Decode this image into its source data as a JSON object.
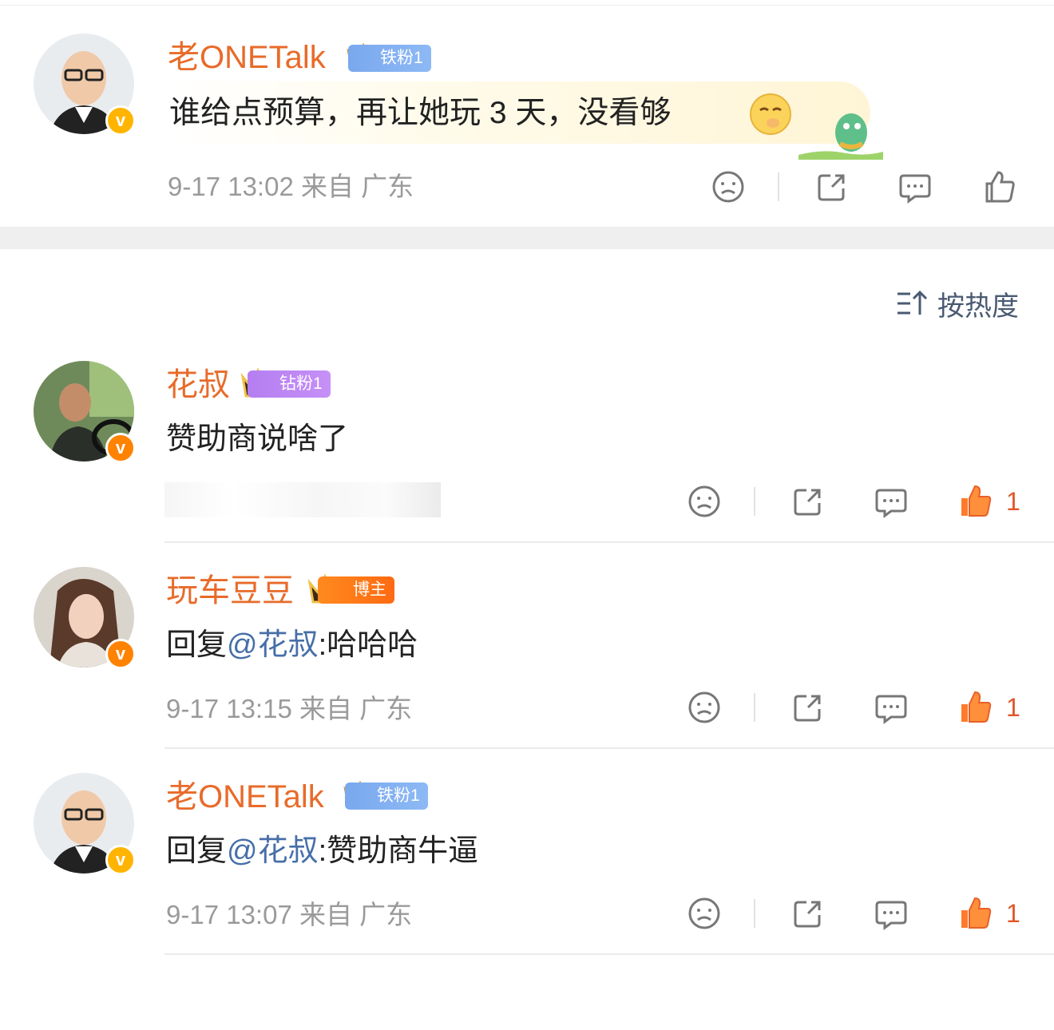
{
  "post": {
    "username": "老ONETalk",
    "fan_badge": "铁粉1",
    "text": "谁给点预算，再让她玩 3 天，没看够",
    "meta": "9-17 13:02  来自 广东"
  },
  "sort": {
    "label": "按热度",
    "icon": "sort-up-icon"
  },
  "comments": [
    {
      "username": "花叔",
      "fan_badge": "钻粉1",
      "text": "赞助商说啥了",
      "meta": "",
      "likes": "1"
    },
    {
      "username": "玩车豆豆",
      "fan_badge": "博主",
      "reply_prefix": "回复",
      "mention": "@花叔",
      "text": ":哈哈哈",
      "meta": "9-17 13:15  来自 广东",
      "likes": "1"
    },
    {
      "username": "老ONETalk",
      "fan_badge": "铁粉1",
      "reply_prefix": "回复",
      "mention": "@花叔",
      "text": ":赞助商牛逼",
      "meta": "9-17 13:07  来自 广东",
      "likes": "1"
    }
  ],
  "colors": {
    "username": "#e86b2a",
    "mention": "#476fa8",
    "like_active": "#ff7a2a",
    "meta_gray": "#9a9a9a"
  }
}
